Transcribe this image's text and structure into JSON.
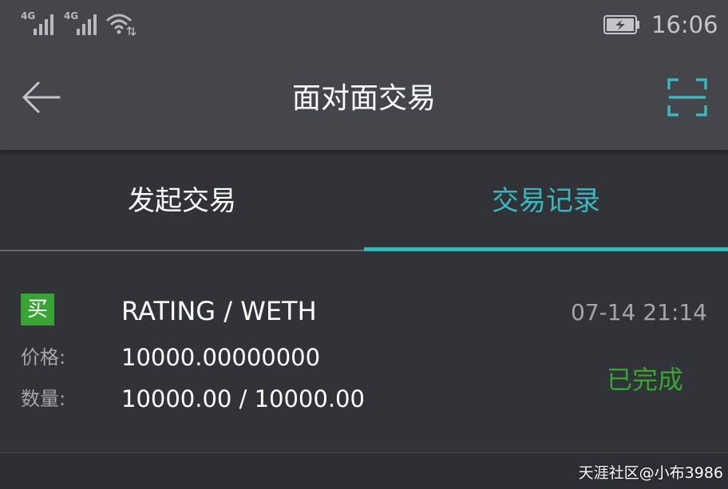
{
  "status_bar": {
    "signals": [
      {
        "network": "4G"
      },
      {
        "network": "4G"
      }
    ],
    "wifi_icon": "wifi-icon",
    "battery_icon": "battery-charging-icon",
    "time": "16:06"
  },
  "app_bar": {
    "back_icon": "arrow-left-icon",
    "title": "面对面交易",
    "scan_icon": "scan-icon"
  },
  "tabs": [
    {
      "label": "发起交易",
      "active": false
    },
    {
      "label": "交易记录",
      "active": true
    }
  ],
  "record": {
    "side_badge": "买",
    "pair": "RATING / WETH",
    "datetime": "07-14 21:14",
    "price_label": "价格:",
    "price_value": "10000.00000000",
    "amount_label": "数量:",
    "amount_value": "10000.00 / 10000.00",
    "status": "已完成"
  },
  "watermark": "天涯社区@小布3986",
  "colors": {
    "accent": "#3cb6bd",
    "buy_green": "#37a433",
    "bar_bg": "#45464c",
    "content_bg": "#323338"
  }
}
